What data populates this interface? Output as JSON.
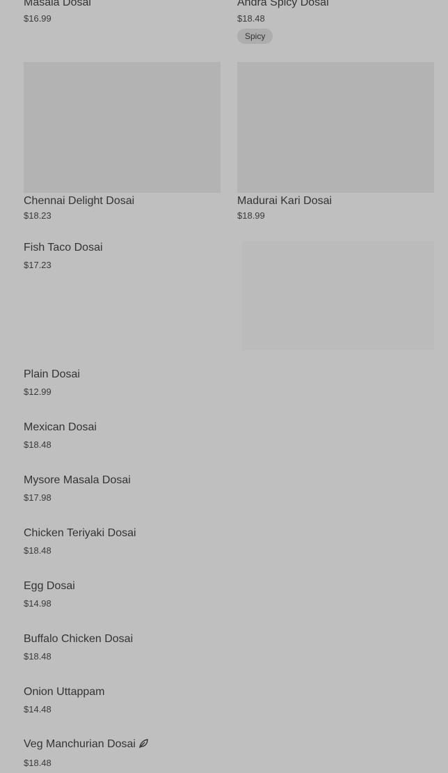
{
  "top_row": {
    "left": {
      "name": "Masala Dosai",
      "price": "$16.99"
    },
    "right": {
      "name": "Andra Spicy Dosai",
      "price": "$18.48",
      "badge": "Spicy"
    }
  },
  "image_row": {
    "left": {
      "name": "Chennai Delight Dosai",
      "price": "$18.23"
    },
    "right": {
      "name": "Madurai Kari Dosai",
      "price": "$18.99"
    }
  },
  "featured": {
    "name": "Fish Taco Dosai",
    "price": "$17.23"
  },
  "list": [
    {
      "name": "Plain Dosai",
      "price": "$12.99"
    },
    {
      "name": "Mexican Dosai",
      "price": "$18.48"
    },
    {
      "name": "Mysore Masala Dosai",
      "price": "$17.98"
    },
    {
      "name": "Chicken Teriyaki Dosai",
      "price": "$18.48"
    },
    {
      "name": "Egg Dosai",
      "price": "$14.98"
    },
    {
      "name": "Buffalo Chicken Dosai",
      "price": "$18.48"
    },
    {
      "name": "Onion Uttappam",
      "price": "$14.48"
    },
    {
      "name": "Veg Manchurian Dosai",
      "price": "$18.48",
      "icon": "leaf-icon"
    }
  ]
}
